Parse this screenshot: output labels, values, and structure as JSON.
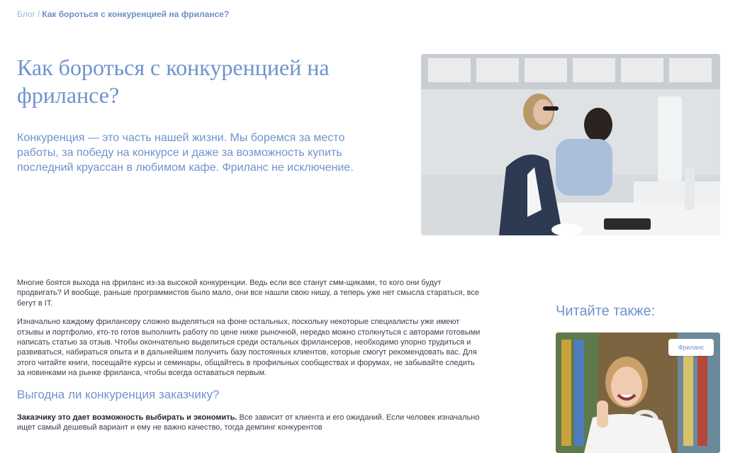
{
  "breadcrumb": {
    "root": "Блог",
    "separator": "/",
    "current": "Как бороться с конкуренцией на фрилансе?"
  },
  "hero": {
    "title": "Как бороться с конкуренцией на фрилансе?",
    "lead": "Конкуренция — это часть нашей жизни. Мы боремся за место работы, за победу на конкурсе и даже за возможность купить последний круассан в любимом кафе. Фриланс не исключение.",
    "image_icon": "office-workers-photo"
  },
  "article": {
    "p1": "Многие боятся выхода на фриланс из-за высокой конкуренции. Ведь если все станут смм-щиками, то кого они будут продвигать? И вообще, раньше программистов было мало, они все нашли свою нишу, а теперь уже нет смысла стараться, все бегут в IT.",
    "p2": "Изначально каждому фрилансеру сложно выделяться на фоне остальных, поскольку некоторые специалисты уже имеют отзывы и портфолио, кто-то готов выполнить работу по цене ниже рыночной, нередко можно столкнуться с авторами готовыми написать статью за отзыв. Чтобы окончательно выделиться среди остальных фрилансеров, необходимо упорно трудиться и развиваться, набираться опыта и в дальнейшем получить базу постоянных клиентов, которые смогут рекомендовать вас. Для этого читайте книги, посещайте курсы и семинары, общайтесь в профильных сообществах и форумах, не забывайте следить за новинками на рынке фриланса, чтобы всегда оставаться первым.",
    "h2": "Выгодна ли конкуренция заказчику?",
    "p3_bold": "Заказчику это дает возможность выбирать и экономить.",
    "p3_rest": " Все зависит от клиента и его ожиданий. Если человек изначально ищет самый дешевый вариант и ему не важно качество, тогда демпинг конкурентов"
  },
  "aside": {
    "title": "Читайте также:",
    "card_tag": "Фриланс",
    "card_image_icon": "smiling-woman-thumbs-up-photo"
  },
  "colors": {
    "accent": "#6f93cc",
    "breadcrumb_link": "#9fb8de",
    "body_text": "#3a3f4a"
  }
}
